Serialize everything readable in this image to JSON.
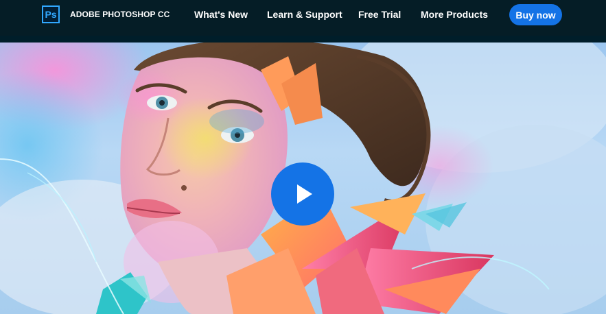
{
  "header": {
    "logo_text": "Ps",
    "brand": "ADOBE PHOTOSHOP CC",
    "nav": [
      {
        "label": "What's New"
      },
      {
        "label": "Learn & Support"
      },
      {
        "label": "Free Trial"
      },
      {
        "label": "More Products"
      }
    ],
    "buy_label": "Buy now"
  },
  "hero": {
    "play_icon": "play-icon"
  },
  "colors": {
    "navbar_bg": "#051d26",
    "accent": "#1473e6",
    "ps_blue": "#31a8ff"
  }
}
